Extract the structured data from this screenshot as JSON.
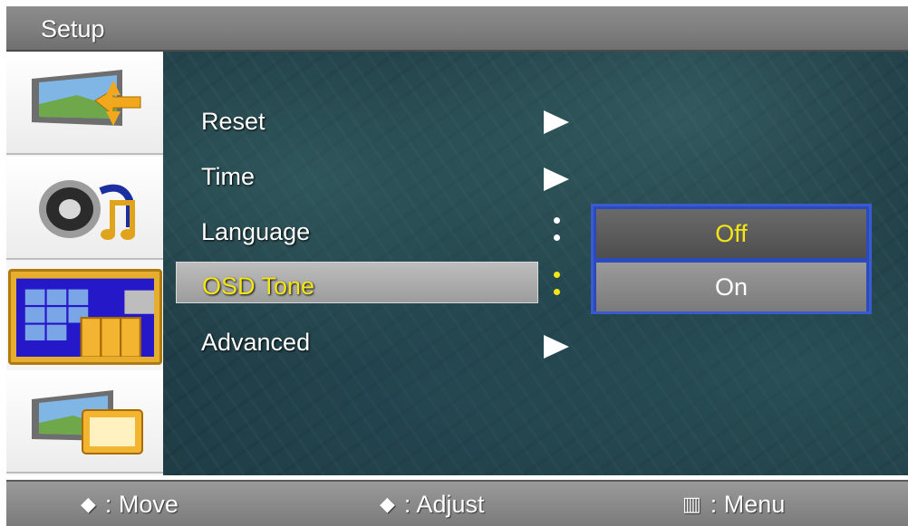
{
  "title": "Setup",
  "sidebar": {
    "items": [
      {
        "icon": "picture-input-icon"
      },
      {
        "icon": "sound-speaker-icon"
      },
      {
        "icon": "setup-grid-icon",
        "active": true
      },
      {
        "icon": "display-screen-icon"
      }
    ]
  },
  "menu": {
    "items": [
      {
        "label": "Reset"
      },
      {
        "label": "Time"
      },
      {
        "label": "Language"
      },
      {
        "label": "OSD Tone"
      },
      {
        "label": "Advanced"
      }
    ]
  },
  "popup": {
    "options": [
      {
        "label": "Off",
        "highlighted": true
      },
      {
        "label": "On"
      }
    ]
  },
  "footer": {
    "move_symbol": "◆",
    "move": ": Move",
    "adjust_symbol": "◆",
    "adjust": ": Adjust",
    "menu_symbol": "▥",
    "menu": ":  Menu"
  },
  "colors": {
    "highlight_text": "#f4e616",
    "popup_border": "#3a5bd0",
    "active_sidebar": "#e6ad2e"
  }
}
